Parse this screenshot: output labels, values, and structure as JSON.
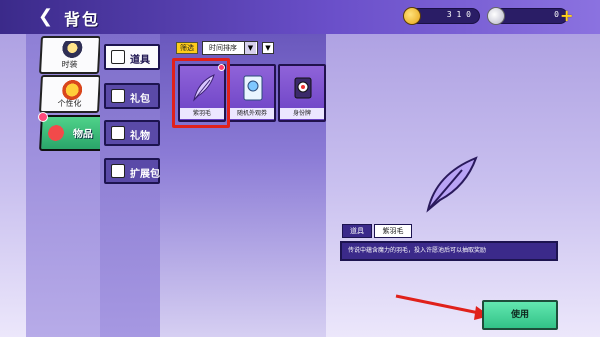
{
  "header": {
    "title": "背包",
    "gold_amount": "3 1 0",
    "gem_amount": "0"
  },
  "categories": [
    {
      "label": "时装"
    },
    {
      "label": "个性化"
    },
    {
      "label": "物品"
    }
  ],
  "subtabs": [
    {
      "label": "道具"
    },
    {
      "label": "礼包"
    },
    {
      "label": "礼物"
    },
    {
      "label": "扩展包"
    }
  ],
  "filter": {
    "badge": "筛选",
    "sort_value": "时间排序"
  },
  "items": [
    {
      "name": "紫羽毛",
      "icon": "feather-icon"
    },
    {
      "name": "随机外观券",
      "icon": "ticket-icon"
    },
    {
      "name": "身份牌",
      "icon": "badge-icon"
    }
  ],
  "detail": {
    "type_tab": "道具",
    "name_tab": "紫羽毛",
    "description": "传说中蕴含魔力的羽毛，投入许愿池后可以抽取奖励",
    "use_label": "使用"
  },
  "colors": {
    "accent": "#6a4fc9",
    "highlight": "#e0211b",
    "use_button": "#32c287"
  }
}
